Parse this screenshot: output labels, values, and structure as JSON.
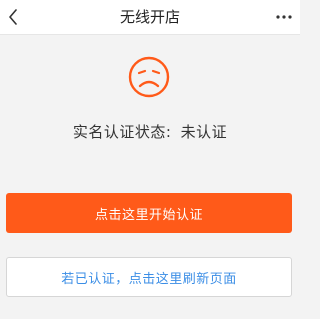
{
  "header": {
    "title": "无线开店",
    "back_icon": "chevron-left-icon",
    "more_icon": "more-dots-icon"
  },
  "status": {
    "icon": "sad-face-icon",
    "label": "实名认证状态:",
    "value": "未认证"
  },
  "actions": {
    "primary_label": "点击这里开始认证",
    "secondary_label": "若已认证，点击这里刷新页面"
  },
  "colors": {
    "accent": "#ff5a19",
    "link": "#3b8ee6",
    "background": "#f3f3f3"
  }
}
